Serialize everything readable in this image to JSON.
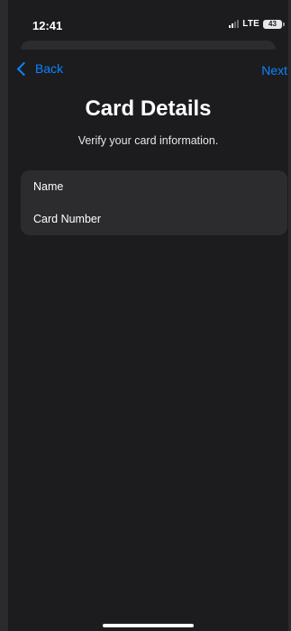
{
  "status_bar": {
    "time": "12:41",
    "network": "LTE",
    "battery": "43"
  },
  "nav": {
    "back_label": "Back",
    "next_label": "Next"
  },
  "header": {
    "title": "Card Details",
    "subtitle": "Verify your card information."
  },
  "form": {
    "fields": [
      {
        "label": "Name"
      },
      {
        "label": "Card Number"
      }
    ]
  },
  "colors": {
    "accent": "#0a84ff",
    "background": "#1c1c1e",
    "grouped_cell": "#2c2c2e",
    "text_primary": "#ffffff"
  },
  "icons": {
    "back": "chevron-left-icon",
    "signal": "signal-icon",
    "battery": "battery-icon"
  }
}
